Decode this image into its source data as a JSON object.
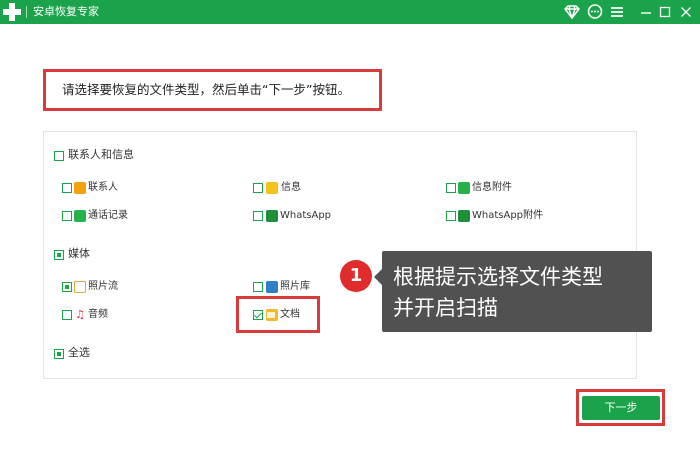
{
  "window": {
    "title": "安卓恢复专家",
    "controls": [
      "vip-icon",
      "feedback-icon",
      "menu-icon",
      "minimize-icon",
      "maximize-icon",
      "close-icon"
    ]
  },
  "instruction": "请选择要恢复的文件类型，然后单击“下一步”按钮。",
  "groups": {
    "contacts": {
      "label": "联系人和信息",
      "checked": false,
      "items": [
        {
          "label": "联系人",
          "icon": "contact-icon",
          "checked": false
        },
        {
          "label": "信息",
          "icon": "message-icon",
          "checked": false
        },
        {
          "label": "信息附件",
          "icon": "attachment-icon",
          "checked": false
        },
        {
          "label": "通话记录",
          "icon": "call-log-icon",
          "checked": false
        },
        {
          "label": "WhatsApp",
          "icon": "whatsapp-icon",
          "checked": false
        },
        {
          "label": "WhatsApp附件",
          "icon": "whatsapp-attachment-icon",
          "checked": false
        }
      ]
    },
    "media": {
      "label": "媒体",
      "checked": true,
      "items": [
        {
          "label": "照片流",
          "icon": "photo-stream-icon",
          "checked": true
        },
        {
          "label": "照片库",
          "icon": "photo-library-icon",
          "checked": false
        },
        {
          "label": "音频",
          "icon": "audio-icon",
          "checked": false
        },
        {
          "label": "文档",
          "icon": "document-folder-icon",
          "checked": true
        }
      ]
    },
    "select_all": {
      "label": "全选",
      "checked": true
    }
  },
  "tooltip": {
    "step": "1",
    "line1": "根据提示选择文件类型",
    "line2": "并开启扫描"
  },
  "next_button": "下一步",
  "colors": {
    "brand_green": "#1aa34a",
    "highlight_red": "#d93b3b",
    "tooltip_bg": "#515151"
  }
}
